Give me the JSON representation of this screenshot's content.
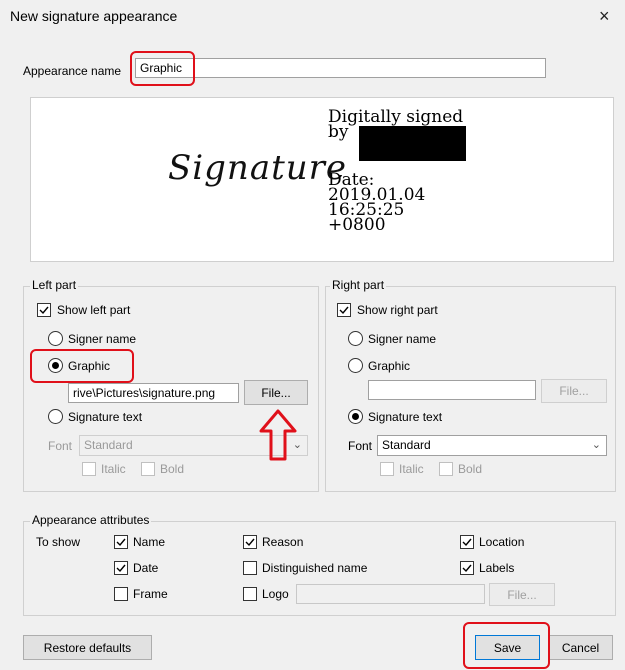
{
  "window": {
    "title": "New signature appearance",
    "close_glyph": "×"
  },
  "appearance_name": {
    "label": "Appearance name",
    "value": "Graphic"
  },
  "preview": {
    "signature_image_text": "Signature",
    "signed_by": "Digitally signed\nby",
    "date_text": "Date:\n2019.01.04\n16:25:25\n+0800"
  },
  "left_part": {
    "legend": "Left part",
    "show_label": "Show left part",
    "show_checked": true,
    "options": {
      "signer_name": "Signer name",
      "graphic": "Graphic",
      "signature_text": "Signature text"
    },
    "selected": "graphic",
    "file_path": "rive\\Pictures\\signature.png",
    "file_button": "File...",
    "font_label": "Font",
    "font_value": "Standard",
    "italic_label": "Italic",
    "bold_label": "Bold"
  },
  "right_part": {
    "legend": "Right part",
    "show_label": "Show right part",
    "show_checked": true,
    "options": {
      "signer_name": "Signer name",
      "graphic": "Graphic",
      "signature_text": "Signature text"
    },
    "selected": "signature_text",
    "file_path": "",
    "file_button": "File...",
    "font_label": "Font",
    "font_value": "Standard",
    "italic_label": "Italic",
    "bold_label": "Bold"
  },
  "attributes": {
    "legend": "Appearance attributes",
    "to_show_label": "To show",
    "name": "Name",
    "reason": "Reason",
    "location": "Location",
    "date": "Date",
    "distinguished_name": "Distinguished name",
    "labels": "Labels",
    "frame": "Frame",
    "logo": "Logo",
    "logo_path": "",
    "file_button": "File..."
  },
  "buttons": {
    "restore": "Restore defaults",
    "save": "Save",
    "cancel": "Cancel"
  },
  "colors": {
    "annotation_red": "#e0101a",
    "redaction": "#000000"
  }
}
